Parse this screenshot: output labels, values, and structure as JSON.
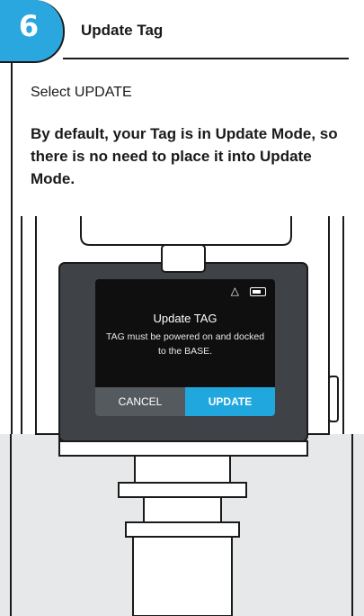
{
  "step": {
    "number": "6",
    "title": "Update Tag"
  },
  "instruction": "Select UPDATE",
  "note": "By default, your Tag is in Update Mode, so there is no need to place it into Update Mode.",
  "device_screen": {
    "icons": [
      "wifi-icon",
      "battery-icon"
    ],
    "title": "Update TAG",
    "message": "TAG must be powered on and docked to the BASE.",
    "cancel_label": "CANCEL",
    "update_label": "UPDATE"
  },
  "colors": {
    "accent": "#2aa7de",
    "button_update": "#20a7de",
    "button_cancel": "#555a5e",
    "background_gray": "#e6e8e9"
  }
}
